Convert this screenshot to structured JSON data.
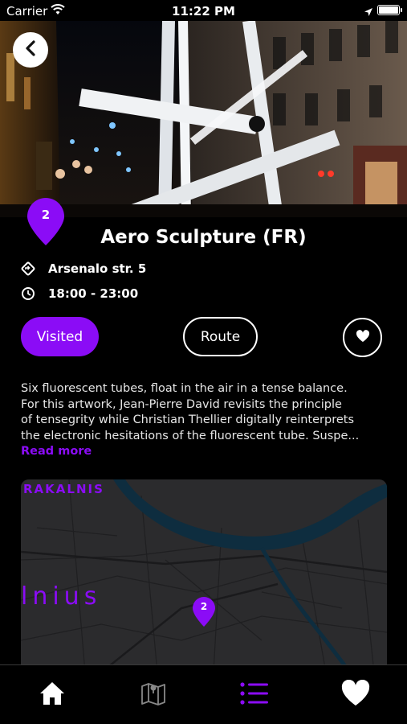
{
  "status_bar": {
    "carrier": "Carrier",
    "time": "11:22 PM"
  },
  "hero": {
    "image": "illuminated-tube-sculpture-night-street"
  },
  "event": {
    "pin_number": "2",
    "title": "Aero Sculpture (FR)",
    "address": "Arsenalo str. 5",
    "hours": "18:00 - 23:00"
  },
  "actions": {
    "visited_label": "Visited",
    "route_label": "Route"
  },
  "description": {
    "lines": [
      "Six fluorescent tubes, float in the air in a tense balance.",
      "For this artwork, Jean-Pierre David revisits the principle",
      "of tensegrity while Christian Thellier digitally reinterprets",
      "the electronic hesitations of the fluorescent tube. Suspe..."
    ],
    "read_more": "Read more"
  },
  "map": {
    "label_top": "RAKALNIS",
    "label_mid": "lnius",
    "pin_number": "2"
  },
  "tab_bar": {
    "tabs": [
      "home-icon",
      "map-icon",
      "list-icon",
      "heart-icon"
    ]
  },
  "colors": {
    "accent": "#8b0cf6",
    "background": "#000000",
    "map_bg": "#2b2b2d"
  }
}
